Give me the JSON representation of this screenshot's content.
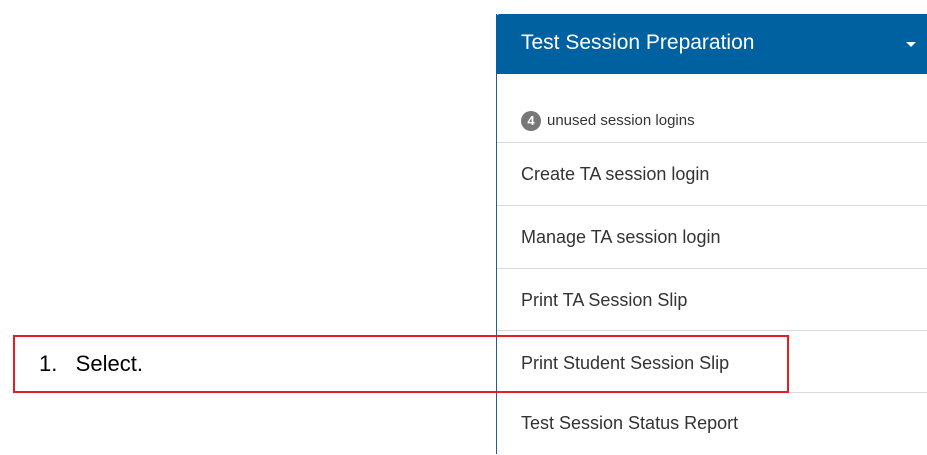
{
  "panel": {
    "title": "Test Session Preparation",
    "badge_count": "4",
    "badge_text": "unused session logins",
    "items": [
      {
        "label": "Create TA session login"
      },
      {
        "label": "Manage TA session login"
      },
      {
        "label": "Print TA Session Slip"
      },
      {
        "label": "Print Student Session Slip"
      },
      {
        "label": "Test Session Status Report"
      }
    ]
  },
  "callout": {
    "text": "1.   Select."
  },
  "colors": {
    "header_bg": "#0061a0",
    "callout_border": "#e01f26",
    "badge_bg": "#777777"
  }
}
